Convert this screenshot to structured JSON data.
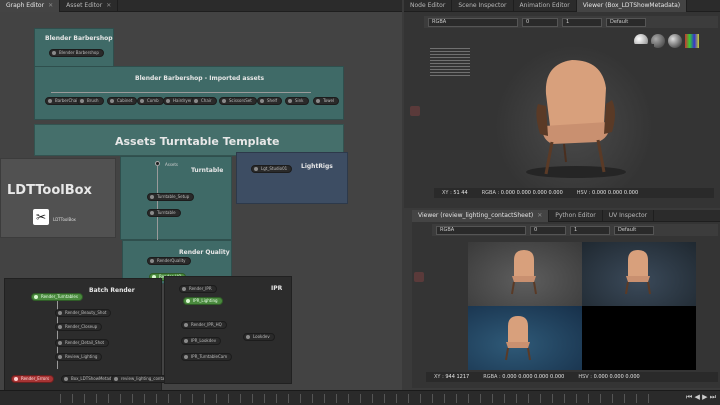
{
  "left_tabs": [
    {
      "label": "Graph Editor",
      "active": true
    },
    {
      "label": "Asset Editor",
      "active": false
    }
  ],
  "top_right_tabs": [
    {
      "label": "Node Editor",
      "active": false
    },
    {
      "label": "Scene Inspector",
      "active": false
    },
    {
      "label": "Animation Editor",
      "active": false
    },
    {
      "label": "Viewer (Box_LDTShowMetadata)",
      "active": true
    }
  ],
  "bottom_right_tabs": [
    {
      "label": "Viewer (review_lighting_contactSheet)",
      "active": true
    },
    {
      "label": "Python Editor",
      "active": false
    },
    {
      "label": "UV Inspector",
      "active": false
    }
  ],
  "graph": {
    "blender_barbershop": {
      "title": "Blender Barbershop",
      "node": "Blender Barbershop"
    },
    "imported_assets": {
      "title": "Blender Barbershop - Imported assets",
      "nodes": [
        "BarberChair",
        "Brush",
        "Cabinet",
        "Comb",
        "Hairdryer",
        "Chair",
        "ScissorsSet",
        "Shelf",
        "Sink",
        "Towel"
      ]
    },
    "turntable_template": {
      "title": "Assets Turntable Template"
    },
    "ldt_toolbox": {
      "title": "LDTToolBox",
      "node": "LDTToolBox"
    },
    "turntable": {
      "title": "Turntable",
      "source_label": "Assets",
      "nodes": [
        "Turntable_Setup",
        "Turntable"
      ]
    },
    "lightrigs": {
      "title": "LightRigs",
      "node": "Lgt_Studio01"
    },
    "render_quality": {
      "title": "Render Quality",
      "nodes": [
        "RenderQuality",
        "Render_HQ"
      ]
    },
    "batch_render": {
      "title": "Batch Render",
      "nodes": [
        "Render_Turntables",
        "Render_Beauty_Shot",
        "Render_Closeup",
        "Render_Detail_Shot",
        "Review_Lighting",
        "Box_LDTShowMetadata",
        "review_lighting_contactSheet"
      ],
      "error_node": "Render_Errors"
    },
    "ipr": {
      "title": "IPR",
      "nodes": [
        "Render_IPR",
        "IPR_Lighting",
        "Render_IPR_HQ",
        "IPR_Lookdev",
        "IPR_TurntableCam",
        "Lookdev"
      ]
    }
  },
  "viewer_top": {
    "channel": "RGBA",
    "exposure": "0",
    "gamma": "1",
    "colorspace": "Default",
    "xy_label": "XY :",
    "xy_value": "51 44",
    "rgba_label": "RGBA :",
    "rgba_value": "0.000 0.000 0.000 0.000",
    "hsv_label": "HSV :",
    "hsv_value": "0.000 0.000 0.000"
  },
  "viewer_bottom": {
    "channel": "RGBA",
    "exposure": "0",
    "gamma": "1",
    "colorspace": "Default",
    "xy_label": "XY :",
    "xy_value": "944 1217",
    "rgba_label": "RGBA :",
    "rgba_value": "0.000 0.000 0.000 0.000",
    "hsv_label": "HSV :",
    "hsv_value": "0.000 0.000 0.000"
  },
  "colors": {
    "teal_box": "#3f6a67",
    "slate_box": "#3d4d63",
    "dark_box": "#2c2c2c",
    "green_node": "#4a8a3e",
    "red_node": "#a73434",
    "chair_fabric": "#d8a07c",
    "chair_wood": "#5a3a26"
  }
}
